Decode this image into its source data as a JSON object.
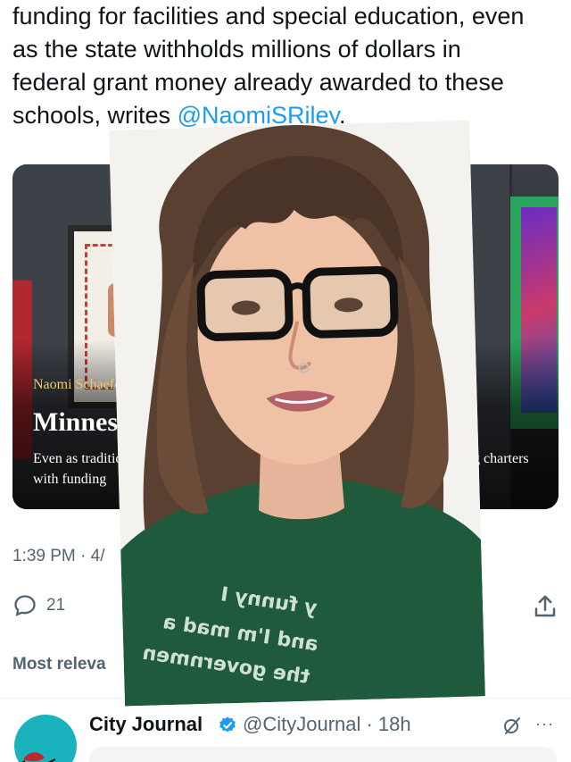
{
  "tweet": {
    "text_lines": [
      "funding for facilities and special education, even",
      "as the state withholds millions of dollars in",
      "federal grant money already awarded to these"
    ],
    "last_line_prefix": "schools, writes ",
    "mention": "@NaomiSRiley",
    "last_line_suffix": "."
  },
  "card": {
    "byline": "Naomi Schaefer Ril",
    "headline": "Minnesota",
    "summary_line1": "Even as tradition",
    "summary_line2": "with funding",
    "summary_right": "ng charters"
  },
  "meta": {
    "timestamp": "1:39 PM · 4/",
    "reply_count": "21",
    "sort_label": "Most releva"
  },
  "reply": {
    "name": "City Journal",
    "handle": "@CityJournal · 18h",
    "more": "···"
  },
  "overlay": {
    "shirt_line1": "y funny I",
    "shirt_line2": "and I'm mad a",
    "shirt_line3": "the governmen"
  },
  "colors": {
    "accent": "#1d9bf0",
    "secondary_text": "#536471",
    "shirt": "#1f5a3c",
    "hair": "#5a4030"
  }
}
